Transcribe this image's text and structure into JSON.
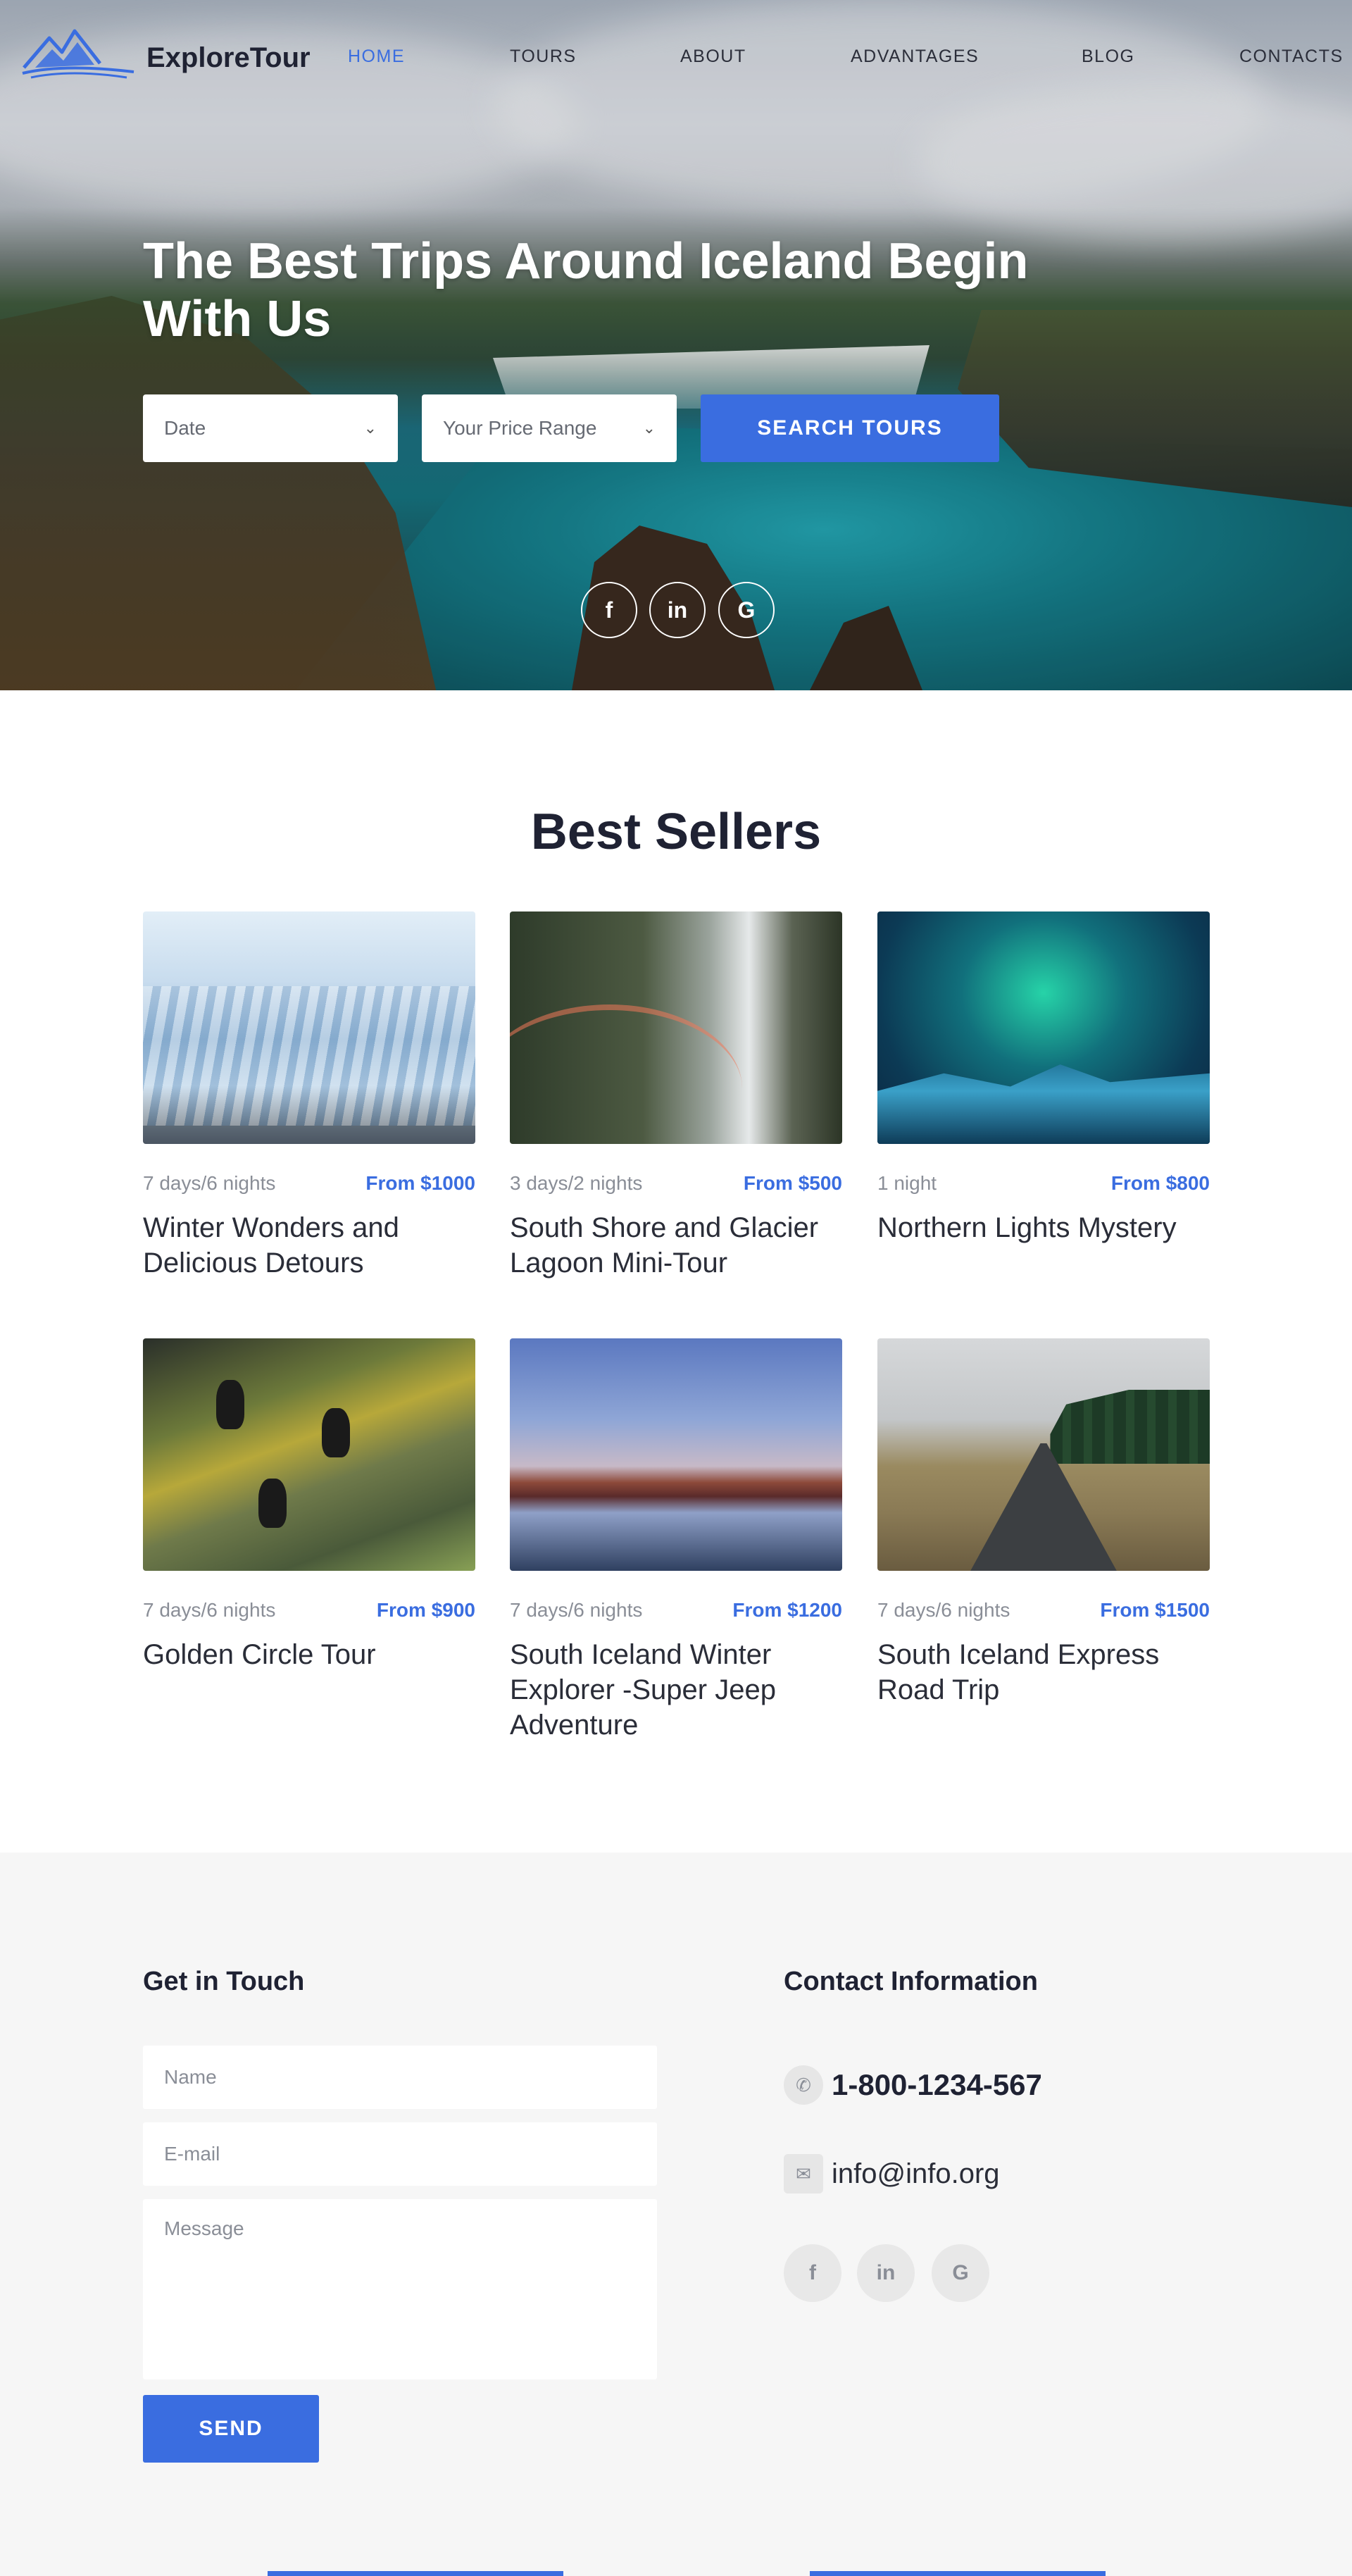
{
  "site": {
    "logo_text": "ExploreTour"
  },
  "nav": {
    "items": [
      {
        "label": "HOME",
        "active": true
      },
      {
        "label": "TOURS",
        "active": false
      },
      {
        "label": "ABOUT",
        "active": false
      },
      {
        "label": "ADVANTAGES",
        "active": false
      },
      {
        "label": "BLOG",
        "active": false
      },
      {
        "label": "CONTACTS",
        "active": false
      }
    ]
  },
  "hero": {
    "title": "The Best Trips Around Iceland Begin With Us",
    "date_select": "Date",
    "price_select": "Your Price Range",
    "search_button": "SEARCH TOURS",
    "social": [
      {
        "icon": "facebook-icon",
        "glyph": "f"
      },
      {
        "icon": "linkedin-icon",
        "glyph": "in"
      },
      {
        "icon": "google-icon",
        "glyph": "G"
      }
    ]
  },
  "best_sellers": {
    "title": "Best Sellers",
    "tours": [
      {
        "duration": "7 days/6 nights",
        "price": "From $1000",
        "title": "Winter Wonders and Delicious Detours",
        "image": "glacier-image"
      },
      {
        "duration": "3 days/2 nights",
        "price": "From $500",
        "title": "South Shore and Glacier Lagoon Mini-Tour",
        "image": "waterfall-rainbow-image"
      },
      {
        "duration": "1 night",
        "price": "From $800",
        "title": "Northern Lights Mystery",
        "image": "aurora-image"
      },
      {
        "duration": "7 days/6 nights",
        "price": "From $900",
        "title": "Golden Circle Tour",
        "image": "puffins-image"
      },
      {
        "duration": "7 days/6 nights",
        "price": "From $1200",
        "title": "South Iceland Winter Explorer -Super Jeep Adventure",
        "image": "mountain-lake-image"
      },
      {
        "duration": "7 days/6 nights",
        "price": "From $1500",
        "title": "South Iceland Express Road Trip",
        "image": "road-image"
      }
    ]
  },
  "footer": {
    "get_in_touch": "Get in Touch",
    "name_placeholder": "Name",
    "email_placeholder": "E-mail",
    "message_placeholder": "Message",
    "send_button": "SEND",
    "contact_info": "Contact Information",
    "phone": "1-800-1234-567",
    "email": "info@info.org",
    "social": [
      {
        "icon": "facebook-icon",
        "glyph": "f"
      },
      {
        "icon": "linkedin-icon",
        "glyph": "in"
      },
      {
        "icon": "google-icon",
        "glyph": "G"
      }
    ]
  },
  "colors": {
    "accent": "#3a6de0",
    "heading": "#1f2233",
    "footer_bg": "#f6f6f6"
  }
}
